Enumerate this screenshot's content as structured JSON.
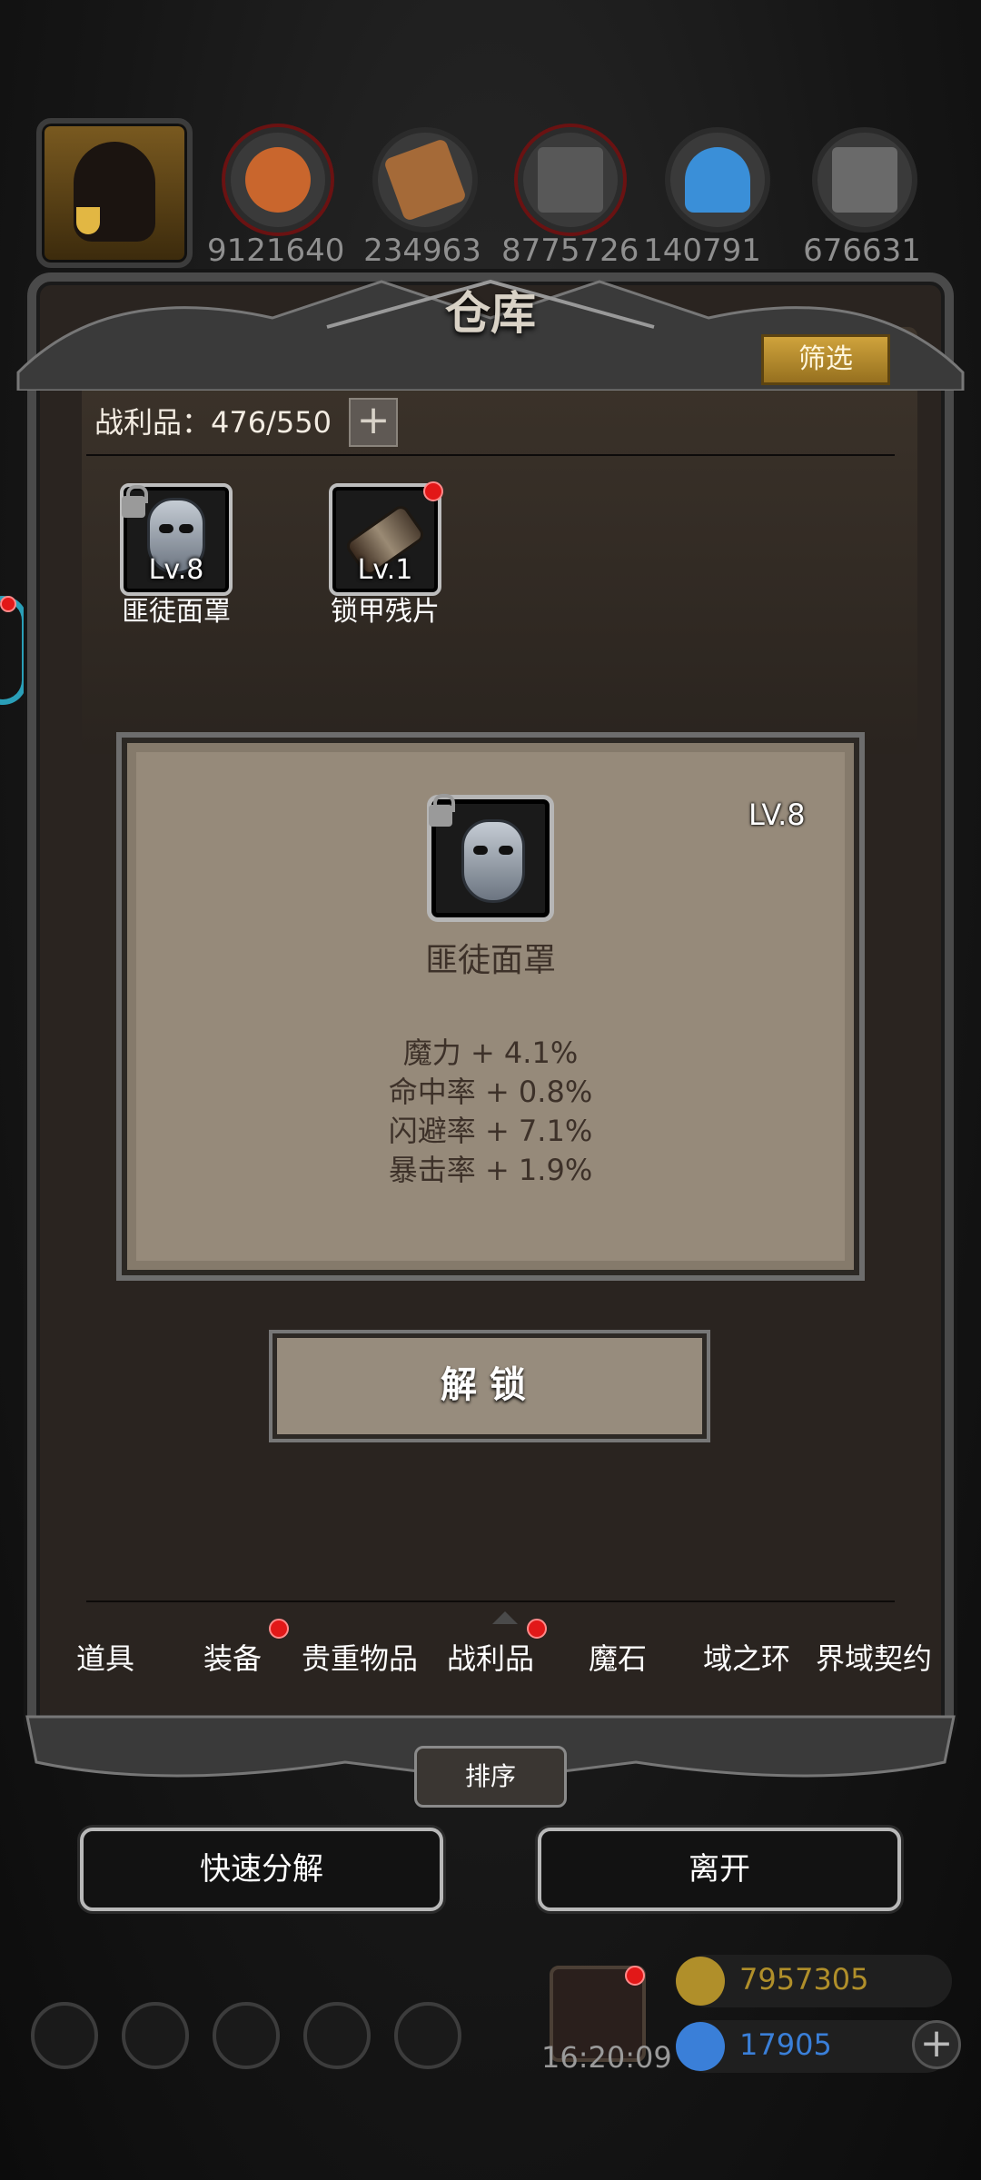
{
  "top_resources": [
    {
      "name": "meat",
      "value": "9121640",
      "color": "#c9662d"
    },
    {
      "name": "wood",
      "value": "234963",
      "color": "#a56a38"
    },
    {
      "name": "iron",
      "value": "8775726",
      "color": "#585858"
    },
    {
      "name": "crystal",
      "value": "140791",
      "color": "#3a8fd8"
    },
    {
      "name": "steel",
      "value": "676631",
      "color": "#6a6a6a"
    }
  ],
  "dialog": {
    "title": "仓库",
    "filter_label": "筛选",
    "capacity_label": "战利品：476/550",
    "add_label": "+"
  },
  "items": [
    {
      "level": "Lv.8",
      "name": "匪徒面罩",
      "locked": true,
      "new": false
    },
    {
      "level": "Lv.1",
      "name": "锁甲残片",
      "locked": false,
      "new": true
    }
  ],
  "detail": {
    "level": "LV.8",
    "name": "匪徒面罩",
    "stats": [
      "魔力 + 4.1%",
      "命中率 + 0.8%",
      "闪避率 + 7.1%",
      "暴击率 + 1.9%"
    ],
    "action_label": "解锁"
  },
  "tabs": [
    {
      "label": "道具",
      "badge": false
    },
    {
      "label": "装备",
      "badge": true
    },
    {
      "label": "贵重物品",
      "badge": false
    },
    {
      "label": "战利品",
      "badge": true,
      "active": true
    },
    {
      "label": "魔石",
      "badge": false
    },
    {
      "label": "域之环",
      "badge": false
    },
    {
      "label": "界域契约",
      "badge": false
    }
  ],
  "footer": {
    "sort_label": "排序",
    "quick_decompose_label": "快速分解",
    "leave_label": "离开"
  },
  "hud": {
    "gift_timer": "16:20:09",
    "gold": "7957305",
    "gems": "17905",
    "gold_color": "#b08f2a",
    "gem_color": "#3a7fd8"
  },
  "colors": {
    "accent_gold": "#c49a35",
    "badge_red": "#e21818",
    "card_bg": "#968a7a"
  }
}
